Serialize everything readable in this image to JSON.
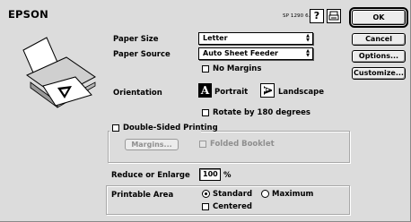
{
  "header": {
    "brand": "EPSON",
    "model": "SP 1290 6.50E"
  },
  "icons": {
    "help": "help-icon",
    "settings": "printer-settings-icon",
    "printer": "printer-illustration"
  },
  "buttons": {
    "ok": "OK",
    "cancel": "Cancel",
    "options": "Options...",
    "customize": "Customize..."
  },
  "paper": {
    "size_label": "Paper Size",
    "size_value": "Letter",
    "source_label": "Paper Source",
    "source_value": "Auto Sheet Feeder",
    "no_margins": "No Margins"
  },
  "orientation": {
    "label": "Orientation",
    "portrait": "Portrait",
    "landscape": "Landscape",
    "rotate": "Rotate by 180 degrees",
    "selected": "Portrait",
    "portrait_glyph": "A",
    "landscape_glyph": "A"
  },
  "double_sided": {
    "label": "Double-Sided Printing",
    "margins": "Margins...",
    "folded": "Folded Booklet"
  },
  "reduce": {
    "label": "Reduce or Enlarge",
    "value": "100",
    "unit": "%"
  },
  "printable": {
    "label": "Printable Area",
    "standard": "Standard",
    "maximum": "Maximum",
    "selected": "Standard",
    "centered": "Centered"
  }
}
